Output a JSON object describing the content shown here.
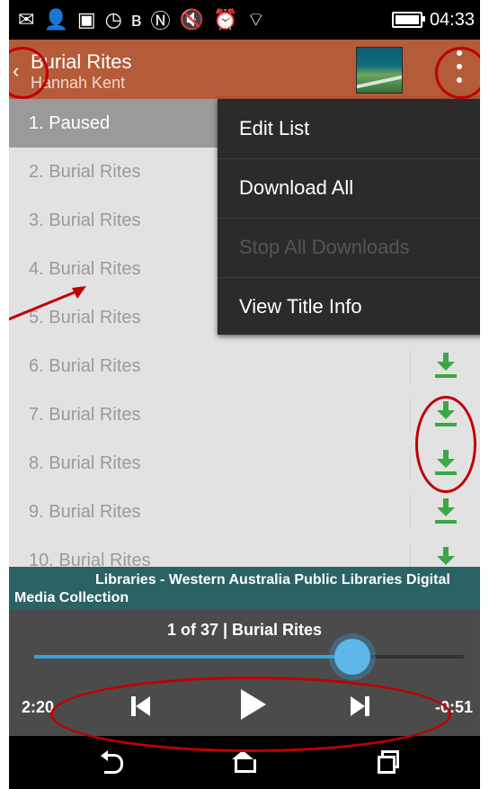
{
  "status_bar": {
    "time": "04:33"
  },
  "app_bar": {
    "title": "Burial Rites",
    "subtitle": "Hannah Kent"
  },
  "list": {
    "header_label": "1. Paused",
    "items": [
      "2. Burial Rites",
      "3. Burial Rites",
      "4. Burial Rites",
      "5. Burial Rites",
      "6. Burial Rites",
      "7. Burial Rites",
      "8. Burial Rites",
      "9. Burial Rites",
      "10. Burial Rites"
    ]
  },
  "menu": {
    "items": [
      "Edit List",
      "Download All",
      "Stop All Downloads",
      "View Title Info"
    ]
  },
  "info_strip": {
    "line1": "Libraries - Western Australia Public Libraries Digital",
    "line2": "Media Collection"
  },
  "player": {
    "track": "1 of 37  |  Burial Rites",
    "time_elapsed": "2:20",
    "time_remaining": "-0:51",
    "progress_fraction": 0.74
  },
  "colors": {
    "app_bar": "#b45b3a",
    "download_green": "#3aa845",
    "progress_blue": "#39a0d6",
    "annotation_red": "#c00000"
  }
}
